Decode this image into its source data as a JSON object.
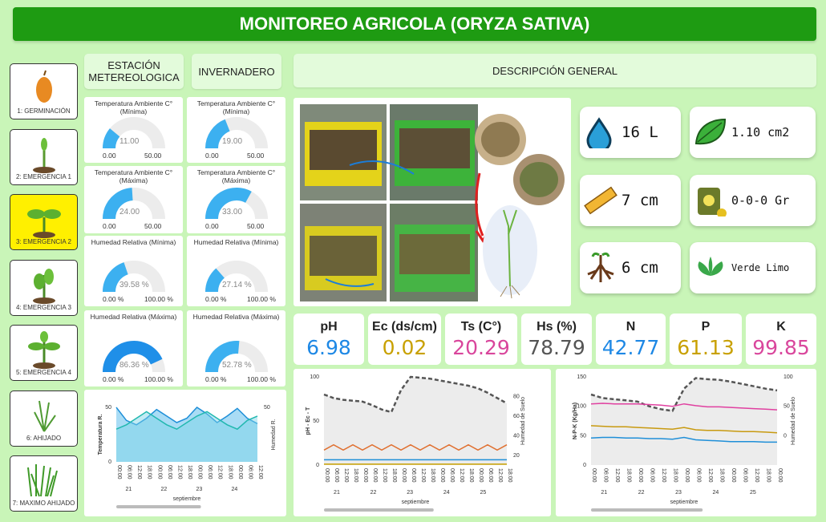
{
  "title": "MONITOREO AGRICOLA (ORYZA SATIVA)",
  "stages": [
    {
      "label": "1: GERMINACIÓN",
      "icon": "seed-icon"
    },
    {
      "label": "2: EMERGENCIA 1",
      "icon": "sprout-icon"
    },
    {
      "label": "3: EMERGENCIA 2",
      "icon": "seedling-icon",
      "active": true
    },
    {
      "label": "4: EMERGENCIA 3",
      "icon": "young-plant-icon"
    },
    {
      "label": "5: EMERGENCIA 4",
      "icon": "plant-icon"
    },
    {
      "label": "6: AHIJADO",
      "icon": "tillering-icon"
    },
    {
      "label": "7: MAXIMO AHIJADO",
      "icon": "grass-icon"
    }
  ],
  "tabs": {
    "station": "ESTACIÓN METEREOLOGICA",
    "greenhouse": "INVERNADERO",
    "overview": "DESCRIPCIÓN GENERAL"
  },
  "gauges": {
    "station": [
      {
        "title": "Temperatura Ambiente C° (Mínima)",
        "value": "11.00",
        "min": "0.00",
        "max": "50.00",
        "fraction": 0.22
      },
      {
        "title": "Temperatura Ambiente C° (Máxima)",
        "value": "24.00",
        "min": "0.00",
        "max": "50.00",
        "fraction": 0.48
      },
      {
        "title": "Humedad Relativa (Mínima)",
        "value": "39.58 %",
        "min": "0.00 %",
        "max": "100.00 %",
        "fraction": 0.3958
      },
      {
        "title": "Humedad Relativa (Máxima)",
        "value": "86.36 %",
        "min": "0.00 %",
        "max": "100.00 %",
        "fraction": 0.8636
      }
    ],
    "greenhouse": [
      {
        "title": "Temperatura Ambiente C° (Mínima)",
        "value": "19.00",
        "min": "0.00",
        "max": "50.00",
        "fraction": 0.38
      },
      {
        "title": "Temperatura Ambiente C° (Máxima)",
        "value": "33.00",
        "min": "0.00",
        "max": "50.00",
        "fraction": 0.66
      },
      {
        "title": "Humedad Relativa (Mínima)",
        "value": "27.14 %",
        "min": "0.00 %",
        "max": "100.00 %",
        "fraction": 0.2714
      },
      {
        "title": "Humedad Relativa (Máxima)",
        "value": "52.78 %",
        "min": "0.00 %",
        "max": "100.00 %",
        "fraction": 0.5278
      }
    ]
  },
  "kpis": [
    {
      "value": "16  L",
      "icon": "water-drop-icon"
    },
    {
      "value": "1.10 cm2",
      "icon": "leaf-icon"
    },
    {
      "value": "7 cm",
      "icon": "ruler-icon"
    },
    {
      "value": "0-0-0 Gr",
      "icon": "fertilizer-bag-icon"
    },
    {
      "value": "6 cm",
      "icon": "roots-icon"
    },
    {
      "value": "Verde Limo",
      "icon": "green-plant-icon"
    }
  ],
  "metrics": [
    {
      "label": "pH",
      "value": "6.98",
      "color": "#1e88e5"
    },
    {
      "label": "Ec (ds/cm)",
      "value": "0.02",
      "color": "#c8a000"
    },
    {
      "label": "Ts (C°)",
      "value": "20.29",
      "color": "#d9469c"
    },
    {
      "label": "Hs (%)",
      "value": "78.79",
      "color": "#555555"
    },
    {
      "label": "N",
      "value": "42.77",
      "color": "#1e88e5"
    },
    {
      "label": "P",
      "value": "61.13",
      "color": "#c8a000"
    },
    {
      "label": "K",
      "value": "99.85",
      "color": "#d9469c"
    }
  ],
  "chart_data": [
    {
      "type": "area",
      "xlabel": "septiembre",
      "ylabel_left": "Temperatura R.",
      "ylabel_right": "Humedad R.",
      "ylim": [
        0,
        50
      ],
      "yticks": [
        "0",
        "50"
      ],
      "yticks_right": [
        "50"
      ],
      "day_labels": [
        "21",
        "22",
        "23",
        "24"
      ],
      "tick_labels": [
        "00:00",
        "06:00",
        "12:00",
        "18:00",
        "00:00",
        "06:00",
        "12:00",
        "18:00",
        "00:00",
        "06:00",
        "12:00",
        "18:00",
        "00:00",
        "06:00",
        "12:00"
      ],
      "series": [
        {
          "values": [
            50,
            38,
            34,
            40,
            48,
            42,
            36,
            40,
            50,
            44,
            36,
            42,
            49,
            40,
            35
          ],
          "color": "#1f8fd8"
        },
        {
          "values": [
            30,
            34,
            40,
            46,
            40,
            34,
            30,
            36,
            42,
            46,
            40,
            34,
            30,
            38,
            42
          ],
          "color": "#22b8b0"
        }
      ]
    },
    {
      "type": "line",
      "xlabel": "septiembre",
      "ylabel_left": "pH - Ec - T",
      "ylabel_right": "Humedad de Suelo",
      "ylim": [
        0,
        100
      ],
      "yticks": [
        "0",
        "50",
        "100"
      ],
      "yticks_right": [
        "20",
        "40",
        "60",
        "80"
      ],
      "day_labels": [
        "21",
        "22",
        "23",
        "24",
        "25"
      ],
      "tick_labels": [
        "00:00",
        "06:00",
        "12:00",
        "18:00",
        "00:00",
        "06:00",
        "12:00",
        "18:00",
        "00:00",
        "06:00",
        "12:00",
        "18:00",
        "00:00",
        "06:00",
        "12:00",
        "18:00",
        "00:00",
        "06:00",
        "12:00",
        "18:00"
      ],
      "series": [
        {
          "values": [
            80,
            76,
            74,
            73,
            72,
            68,
            63,
            60,
            85,
            100,
            99,
            98,
            96,
            94,
            92,
            90,
            87,
            82,
            76,
            70
          ],
          "color": "#555555",
          "dashed": true,
          "area": true
        },
        {
          "values": [
            17,
            23,
            17,
            23,
            17,
            23,
            17,
            23,
            17,
            23,
            17,
            23,
            17,
            23,
            17,
            23,
            17,
            23,
            17,
            23
          ],
          "color": "#e07030"
        },
        {
          "values": [
            6,
            6,
            6,
            6,
            6,
            6,
            6,
            6,
            6,
            6,
            6,
            6,
            6,
            6,
            6,
            6,
            6,
            6,
            6,
            6
          ],
          "color": "#1f8fd8"
        },
        {
          "values": [
            1,
            1,
            1,
            1,
            1,
            1,
            1,
            1,
            1,
            1,
            1,
            1,
            1,
            1,
            1,
            1,
            1,
            1,
            1,
            1
          ],
          "color": "#c8a000"
        }
      ]
    },
    {
      "type": "line",
      "xlabel": "septiembre",
      "ylabel_left": "N-P-K (Kg/Ha)",
      "ylabel_right": "Humedad de Suelo",
      "ylim": [
        0,
        150
      ],
      "yticks": [
        "0",
        "50",
        "100",
        "150"
      ],
      "yticks_right": [
        "0",
        "50",
        "100"
      ],
      "day_labels": [
        "21",
        "22",
        "23",
        "24",
        "25"
      ],
      "tick_labels": [
        "00:00",
        "06:00",
        "12:00",
        "18:00",
        "00:00",
        "06:00",
        "12:00",
        "18:00",
        "00:00",
        "06:00",
        "12:00",
        "18:00",
        "00:00",
        "06:00",
        "12:00",
        "18:00",
        "00:00"
      ],
      "series": [
        {
          "values": [
            120,
            114,
            112,
            110,
            108,
            100,
            95,
            92,
            130,
            148,
            146,
            145,
            142,
            138,
            134,
            130,
            127
          ],
          "color": "#555555",
          "dashed": true,
          "area": true
        },
        {
          "values": [
            104,
            105,
            104,
            104,
            104,
            103,
            102,
            100,
            104,
            101,
            99,
            99,
            98,
            97,
            96,
            95,
            94
          ],
          "color": "#e040a0"
        },
        {
          "values": [
            67,
            66,
            65,
            65,
            64,
            63,
            62,
            61,
            64,
            60,
            59,
            59,
            58,
            57,
            57,
            56,
            55
          ],
          "color": "#c89a10"
        },
        {
          "values": [
            46,
            47,
            47,
            46,
            46,
            45,
            45,
            44,
            47,
            43,
            42,
            41,
            40,
            40,
            40,
            39,
            39
          ],
          "color": "#1f8fd8"
        }
      ]
    }
  ]
}
